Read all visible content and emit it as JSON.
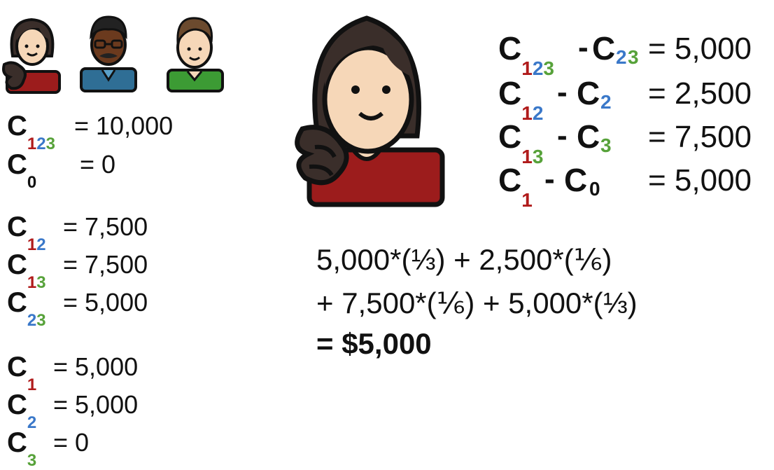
{
  "colors": {
    "red": "#b01b1b",
    "blue": "#3a78c9",
    "green": "#57a23a"
  },
  "avatars": [
    "woman-avatar-icon",
    "man-glasses-avatar-icon",
    "man-avatar-icon",
    "woman-large-avatar-icon"
  ],
  "left": {
    "c": "C",
    "c123": {
      "s1": "1",
      "s2": "2",
      "s3": "3",
      "value": "= 10,000"
    },
    "c0": {
      "s": "0",
      "value": "= 0"
    },
    "c12": {
      "s1": "1",
      "s2": "2",
      "value": "= 7,500"
    },
    "c13": {
      "s1": "1",
      "s2": "3",
      "value": "= 7,500"
    },
    "c23": {
      "s1": "2",
      "s2": "3",
      "value": "= 5,000"
    },
    "c1": {
      "s": "1",
      "value": "= 5,000"
    },
    "c2": {
      "s": "2",
      "value": "= 5,000"
    },
    "c3": {
      "s": "3",
      "value": "= 0"
    }
  },
  "right": {
    "minus": "-",
    "row1": {
      "a1": "1",
      "a2": "2",
      "a3": "3",
      "b1": "2",
      "b2": "3",
      "value": "= 5,000"
    },
    "row2": {
      "a1": "1",
      "a2": "2",
      "b1": "2",
      "value": "= 2,500"
    },
    "row3": {
      "a1": "1",
      "a2": "3",
      "b1": "3",
      "value": "= 7,500"
    },
    "row4": {
      "a1": "1",
      "b1": "0",
      "value": "= 5,000"
    }
  },
  "formula": {
    "line1": "5,000*(⅓) + 2,500*(⅙)",
    "line2": "+ 7,500*(⅙) + 5,000*(⅓)",
    "line3": "= $5,000"
  }
}
